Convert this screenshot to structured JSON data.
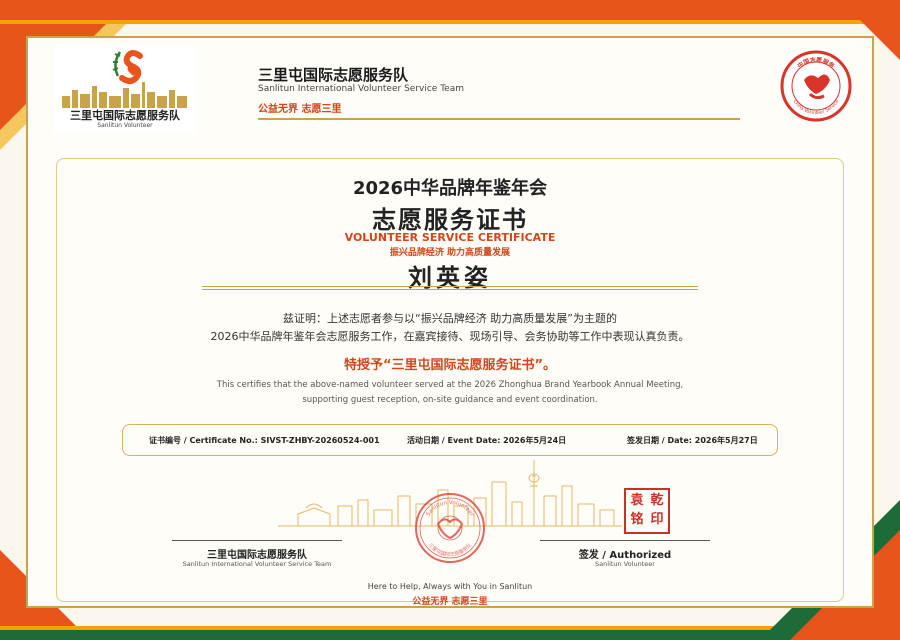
{
  "colors": {
    "accent_orange": "#e8541c",
    "accent_gold": "#c9a34a",
    "accent_green": "#1e6b3a",
    "seal_red": "#c8312a"
  },
  "logo": {
    "title": "三里屯国际志愿服务队",
    "subtitle": "Sanlitun Volunteer"
  },
  "header": {
    "org_name": "三里屯国际志愿服务队",
    "org_name_en": "Sanlitun International Volunteer Service Team",
    "slogan": "公益无界  志愿三里"
  },
  "badge": {
    "text_top": "中国志愿服务",
    "text_bottom": "China Volunteer Service",
    "icon": "volunteer-heart-icon"
  },
  "certificate": {
    "event": "2026中华品牌年鉴年会",
    "title": "志愿服务证书",
    "title_en": "VOLUNTEER SERVICE CERTIFICATE",
    "slogan": "振兴品牌经济  助力高质量发展",
    "recipient": "刘英姿",
    "body_line1": "兹证明：上述志愿者参与以“振兴品牌经济  助力高质量发展”为主题的",
    "body_line2": "2026中华品牌年鉴年会志愿服务工作，在嘉宾接待、现场引导、会务协助等工作中表现认真负责。",
    "award": "特授予“三里屯国际志愿服务证书”。",
    "en_line1": "This certifies that the above-named volunteer served at the 2026 Zhonghua Brand Yearbook Annual Meeting,",
    "en_line2": "supporting guest reception, on-site guidance and event coordination."
  },
  "info": {
    "cert_no": "证书编号 / Certificate No.: SIVST-ZHBY-20260524-001",
    "event_date": "活动日期 / Event Date: 2026年5月24日",
    "issue_date": "签发日期 / Date: 2026年5月27日"
  },
  "signatures": {
    "left_name": "三里屯国际志愿服务队",
    "left_sub": "Sanlitun International Volunteer Service Team",
    "right_name": "签发 / Authorized",
    "right_sub": "Sanlitun Volunteer"
  },
  "seal": {
    "text_top": "Sanlitun Volunteer",
    "text_bottom": "三里屯国际志愿服务队"
  },
  "stamp": {
    "chars": [
      "乾",
      "印",
      "袁",
      "铭"
    ]
  },
  "footer": {
    "tagline": "Here to Help, Always with You in Sanlitun",
    "slogan": "公益无界  志愿三里"
  }
}
